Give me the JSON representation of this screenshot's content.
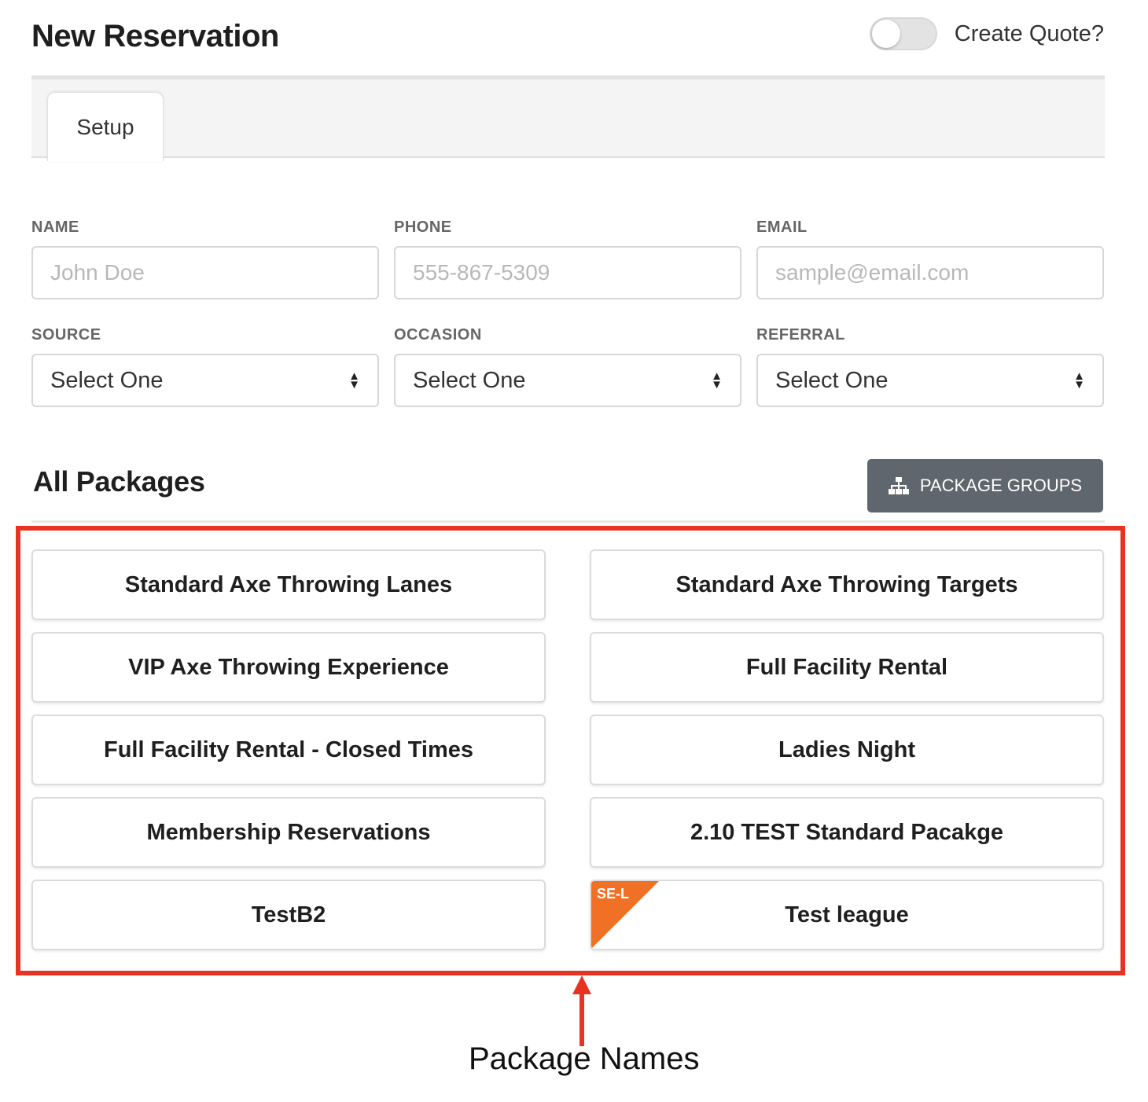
{
  "header": {
    "title": "New Reservation",
    "quote_toggle": {
      "label": "Create Quote?",
      "on": false
    }
  },
  "tabs": [
    {
      "label": "Setup",
      "active": true
    }
  ],
  "form": {
    "name": {
      "label": "NAME",
      "placeholder": "John Doe"
    },
    "phone": {
      "label": "PHONE",
      "placeholder": "555-867-5309"
    },
    "email": {
      "label": "EMAIL",
      "placeholder": "sample@email.com"
    },
    "source": {
      "label": "SOURCE",
      "value": "Select One"
    },
    "occasion": {
      "label": "OCCASION",
      "value": "Select One"
    },
    "referral": {
      "label": "REFERRAL",
      "value": "Select One"
    }
  },
  "packages_section": {
    "title": "All Packages",
    "groups_button": {
      "label": "PACKAGE GROUPS",
      "icon": "sitemap-icon"
    }
  },
  "packages": [
    {
      "name": "Standard Axe Throwing Lanes"
    },
    {
      "name": "Standard Axe Throwing Targets"
    },
    {
      "name": "VIP Axe Throwing Experience"
    },
    {
      "name": "Full Facility Rental"
    },
    {
      "name": "Full Facility Rental - Closed Times"
    },
    {
      "name": "Ladies Night"
    },
    {
      "name": "Membership Reservations"
    },
    {
      "name": "2.10 TEST Standard Pacakge"
    },
    {
      "name": "TestB2"
    },
    {
      "name": "Test league",
      "badge": "SE-L"
    }
  ],
  "annotation": {
    "label": "Package Names"
  },
  "colors": {
    "highlight": "#e83323",
    "badge": "#f07025",
    "button": "#5f666d"
  }
}
